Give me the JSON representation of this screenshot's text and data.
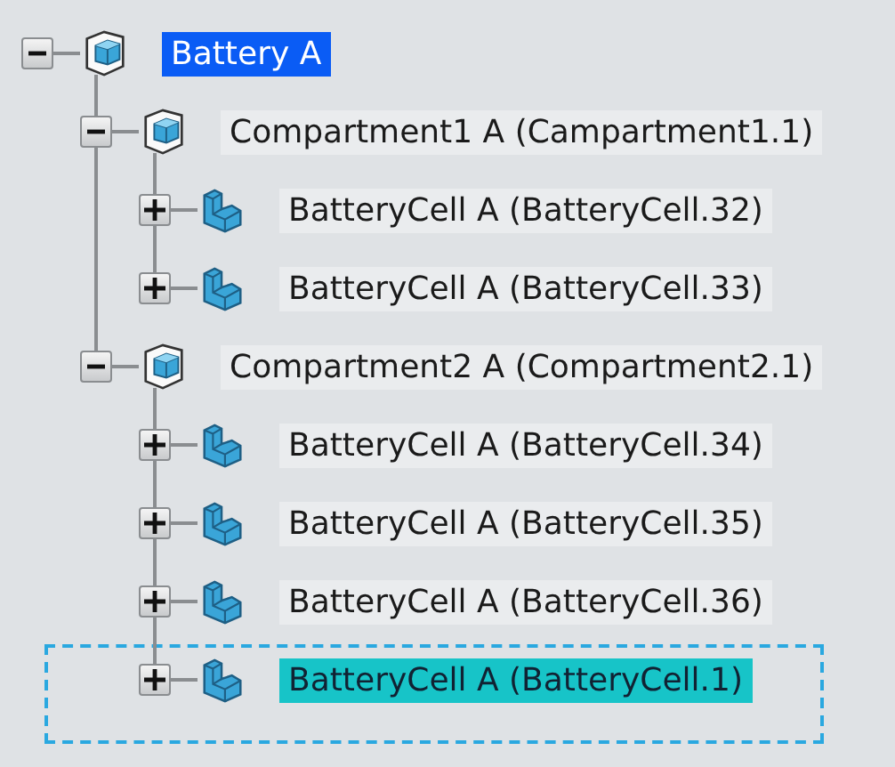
{
  "tree": [
    {
      "label": "Battery A",
      "kind": "assembly",
      "expanded": true,
      "selected": true,
      "highlighted": false,
      "children": [
        {
          "label": "Compartment1 A (Campartment1.1)",
          "kind": "assembly",
          "expanded": true,
          "selected": false,
          "highlighted": false,
          "children": [
            {
              "label": "BatteryCell A (BatteryCell.32)",
              "kind": "part",
              "expanded": false,
              "selected": false,
              "highlighted": false
            },
            {
              "label": "BatteryCell A (BatteryCell.33)",
              "kind": "part",
              "expanded": false,
              "selected": false,
              "highlighted": false
            }
          ]
        },
        {
          "label": "Compartment2 A (Compartment2.1)",
          "kind": "assembly",
          "expanded": true,
          "selected": false,
          "highlighted": false,
          "children": [
            {
              "label": "BatteryCell A (BatteryCell.34)",
              "kind": "part",
              "expanded": false,
              "selected": false,
              "highlighted": false
            },
            {
              "label": "BatteryCell A (BatteryCell.35)",
              "kind": "part",
              "expanded": false,
              "selected": false,
              "highlighted": false
            },
            {
              "label": "BatteryCell A (BatteryCell.36)",
              "kind": "part",
              "expanded": false,
              "selected": false,
              "highlighted": false
            },
            {
              "label": "BatteryCell A (BatteryCell.1)",
              "kind": "part",
              "expanded": false,
              "selected": false,
              "highlighted": true
            }
          ]
        }
      ]
    }
  ]
}
